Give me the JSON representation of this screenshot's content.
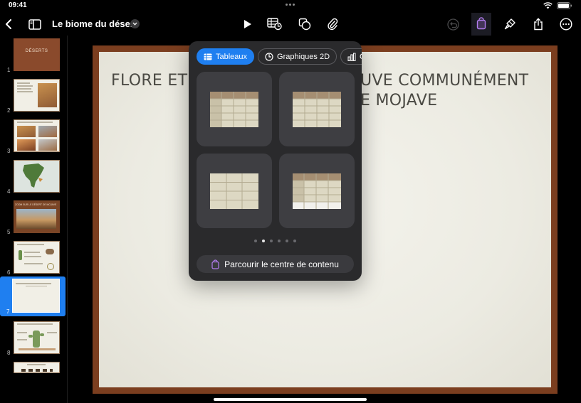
{
  "status": {
    "time": "09:41"
  },
  "toolbar": {
    "document_title": "Le biome du désert"
  },
  "sidebar": {
    "slides": [
      {
        "number": "1",
        "cover_text": "DÉSERTS"
      },
      {
        "number": "2"
      },
      {
        "number": "3"
      },
      {
        "number": "4"
      },
      {
        "number": "5",
        "header_text": "ZOOM SUR LE DÉSERT DE MOJAVE"
      },
      {
        "number": "6"
      },
      {
        "number": "7"
      },
      {
        "number": "8"
      }
    ],
    "selected_slide": "7"
  },
  "slide": {
    "title_line1": "FLORE ET",
    "title_line1_right": "UVE COMMUNÉMENT",
    "title_line2_right": "E MOJAVE"
  },
  "popover": {
    "segments": [
      {
        "label": "Tableaux",
        "icon": "table-icon",
        "active": true
      },
      {
        "label": "Graphiques 2D",
        "icon": "chart-pie-icon",
        "active": false
      },
      {
        "label": "G",
        "icon": "bar-chart-icon",
        "active": false
      }
    ],
    "page_count": 6,
    "current_page": 2,
    "browse_label": "Parcourir le centre de contenu"
  },
  "colors": {
    "accent": "#1f7ff0",
    "slide_frame": "#7b3e1f",
    "table_header": "#a58e72",
    "table_body": "#ddd8c3"
  }
}
